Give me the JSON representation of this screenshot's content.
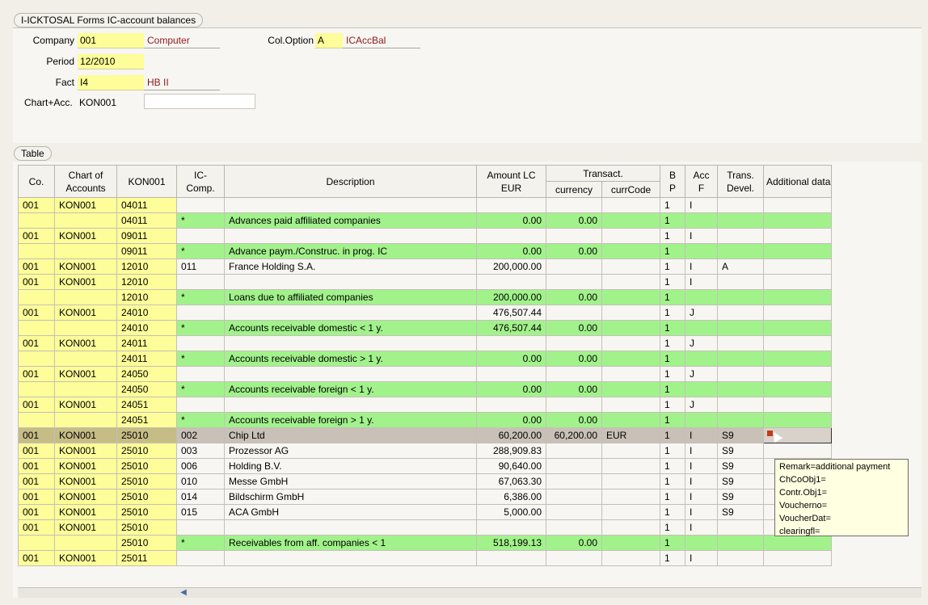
{
  "window_tab": "I-ICKTOSAL Forms IC-account balances",
  "form": {
    "company_label": "Company",
    "company_value": "001",
    "company_desc": "Computer",
    "period_label": "Period",
    "period_value": "12/2010",
    "fact_label": "Fact",
    "fact_value": "I4",
    "fact_desc": "HB II",
    "chart_label": "Chart+Acc.",
    "chart_value": "KON001",
    "coloption_label": "Col.Option",
    "coloption_value": "A",
    "coloption_desc": "ICAccBal"
  },
  "table_tab": "Table",
  "columns": {
    "co": "Co.",
    "chart1": "Chart of",
    "chart2": "Accounts",
    "kon": "KON001",
    "ic1": "IC-",
    "ic2": "Comp.",
    "desc": "Description",
    "amt1": "Amount LC",
    "amt2": "EUR",
    "transact": "Transact.",
    "currency": "currency",
    "currcode": "currCode",
    "bp1": "B",
    "bp2": "P",
    "acc1": "Acc",
    "acc2": "F",
    "trans1": "Trans.",
    "trans2": "Devel.",
    "add": "Additional data"
  },
  "rows": [
    {
      "co": "001",
      "chart": "KON001",
      "acct": "04011",
      "ic": "",
      "desc": "",
      "amt": "",
      "cur": "",
      "code": "",
      "bp": "1",
      "acc": "I",
      "tr": "",
      "type": "normal"
    },
    {
      "co": "",
      "chart": "",
      "acct": "04011",
      "ic": "*",
      "desc": "Advances paid affiliated companies",
      "amt": "0.00",
      "cur": "0.00",
      "code": "",
      "bp": "1",
      "acc": "",
      "tr": "",
      "type": "sum"
    },
    {
      "co": "001",
      "chart": "KON001",
      "acct": "09011",
      "ic": "",
      "desc": "",
      "amt": "",
      "cur": "",
      "code": "",
      "bp": "1",
      "acc": "I",
      "tr": "",
      "type": "normal"
    },
    {
      "co": "",
      "chart": "",
      "acct": "09011",
      "ic": "*",
      "desc": "Advance paym./Construc. in prog. IC",
      "amt": "0.00",
      "cur": "0.00",
      "code": "",
      "bp": "1",
      "acc": "",
      "tr": "",
      "type": "sum"
    },
    {
      "co": "001",
      "chart": "KON001",
      "acct": "12010",
      "ic": "011",
      "desc": "France Holding S.A.",
      "amt": "200,000.00",
      "cur": "",
      "code": "",
      "bp": "1",
      "acc": "I",
      "tr": "A",
      "type": "normal"
    },
    {
      "co": "001",
      "chart": "KON001",
      "acct": "12010",
      "ic": "",
      "desc": "",
      "amt": "",
      "cur": "",
      "code": "",
      "bp": "1",
      "acc": "I",
      "tr": "",
      "type": "normal"
    },
    {
      "co": "",
      "chart": "",
      "acct": "12010",
      "ic": "*",
      "desc": "Loans due to affiliated companies",
      "amt": "200,000.00",
      "cur": "0.00",
      "code": "",
      "bp": "1",
      "acc": "",
      "tr": "",
      "type": "sum"
    },
    {
      "co": "001",
      "chart": "KON001",
      "acct": "24010",
      "ic": "",
      "desc": "",
      "amt": "476,507.44",
      "cur": "",
      "code": "",
      "bp": "1",
      "acc": "J",
      "tr": "",
      "type": "normal"
    },
    {
      "co": "",
      "chart": "",
      "acct": "24010",
      "ic": "*",
      "desc": "Accounts receivable domestic < 1 y.",
      "amt": "476,507.44",
      "cur": "0.00",
      "code": "",
      "bp": "1",
      "acc": "",
      "tr": "",
      "type": "sum"
    },
    {
      "co": "001",
      "chart": "KON001",
      "acct": "24011",
      "ic": "",
      "desc": "",
      "amt": "",
      "cur": "",
      "code": "",
      "bp": "1",
      "acc": "J",
      "tr": "",
      "type": "normal"
    },
    {
      "co": "",
      "chart": "",
      "acct": "24011",
      "ic": "*",
      "desc": "Accounts receivable domestic > 1 y.",
      "amt": "0.00",
      "cur": "0.00",
      "code": "",
      "bp": "1",
      "acc": "",
      "tr": "",
      "type": "sum"
    },
    {
      "co": "001",
      "chart": "KON001",
      "acct": "24050",
      "ic": "",
      "desc": "",
      "amt": "",
      "cur": "",
      "code": "",
      "bp": "1",
      "acc": "J",
      "tr": "",
      "type": "normal"
    },
    {
      "co": "",
      "chart": "",
      "acct": "24050",
      "ic": "*",
      "desc": "Accounts receivable foreign < 1 y.",
      "amt": "0.00",
      "cur": "0.00",
      "code": "",
      "bp": "1",
      "acc": "",
      "tr": "",
      "type": "sum"
    },
    {
      "co": "001",
      "chart": "KON001",
      "acct": "24051",
      "ic": "",
      "desc": "",
      "amt": "",
      "cur": "",
      "code": "",
      "bp": "1",
      "acc": "J",
      "tr": "",
      "type": "normal"
    },
    {
      "co": "",
      "chart": "",
      "acct": "24051",
      "ic": "*",
      "desc": "Accounts receivable foreign > 1 y.",
      "amt": "0.00",
      "cur": "0.00",
      "code": "",
      "bp": "1",
      "acc": "",
      "tr": "",
      "type": "sum"
    },
    {
      "co": "001",
      "chart": "KON001",
      "acct": "25010",
      "ic": "002",
      "desc": "Chip Ltd",
      "amt": "60,200.00",
      "cur": "60,200.00",
      "code": "EUR",
      "bp": "1",
      "acc": "I",
      "tr": "S9",
      "type": "sel"
    },
    {
      "co": "001",
      "chart": "KON001",
      "acct": "25010",
      "ic": "003",
      "desc": "Prozessor AG",
      "amt": "288,909.83",
      "cur": "",
      "code": "",
      "bp": "1",
      "acc": "I",
      "tr": "S9",
      "type": "normal"
    },
    {
      "co": "001",
      "chart": "KON001",
      "acct": "25010",
      "ic": "006",
      "desc": "Holding B.V.",
      "amt": "90,640.00",
      "cur": "",
      "code": "",
      "bp": "1",
      "acc": "I",
      "tr": "S9",
      "type": "normal"
    },
    {
      "co": "001",
      "chart": "KON001",
      "acct": "25010",
      "ic": "010",
      "desc": "Messe GmbH",
      "amt": "67,063.30",
      "cur": "",
      "code": "",
      "bp": "1",
      "acc": "I",
      "tr": "S9",
      "type": "normal"
    },
    {
      "co": "001",
      "chart": "KON001",
      "acct": "25010",
      "ic": "014",
      "desc": "Bildschirm GmbH",
      "amt": "6,386.00",
      "cur": "",
      "code": "",
      "bp": "1",
      "acc": "I",
      "tr": "S9",
      "type": "normal"
    },
    {
      "co": "001",
      "chart": "KON001",
      "acct": "25010",
      "ic": "015",
      "desc": "ACA GmbH",
      "amt": "5,000.00",
      "cur": "",
      "code": "",
      "bp": "1",
      "acc": "I",
      "tr": "S9",
      "type": "normal"
    },
    {
      "co": "001",
      "chart": "KON001",
      "acct": "25010",
      "ic": "",
      "desc": "",
      "amt": "",
      "cur": "",
      "code": "",
      "bp": "1",
      "acc": "I",
      "tr": "",
      "type": "normal"
    },
    {
      "co": "",
      "chart": "",
      "acct": "25010",
      "ic": "*",
      "desc": "Receivables from aff. companies < 1",
      "amt": "518,199.13",
      "cur": "0.00",
      "code": "",
      "bp": "1",
      "acc": "",
      "tr": "",
      "type": "sum"
    },
    {
      "co": "001",
      "chart": "KON001",
      "acct": "25011",
      "ic": "",
      "desc": "",
      "amt": "",
      "cur": "",
      "code": "",
      "bp": "1",
      "acc": "I",
      "tr": "",
      "type": "normal"
    }
  ],
  "tooltip": [
    "Remark=additional payment",
    "ChCoObj1=",
    "Contr.Obj1=",
    "Voucherno=",
    "VoucherDat=",
    "clearingfl="
  ],
  "colors": {
    "key_yellow": "#fdfd99",
    "sum_green": "#a2f28c",
    "selected": "#c9c0b7",
    "desc_red": "#8b1a1a"
  }
}
